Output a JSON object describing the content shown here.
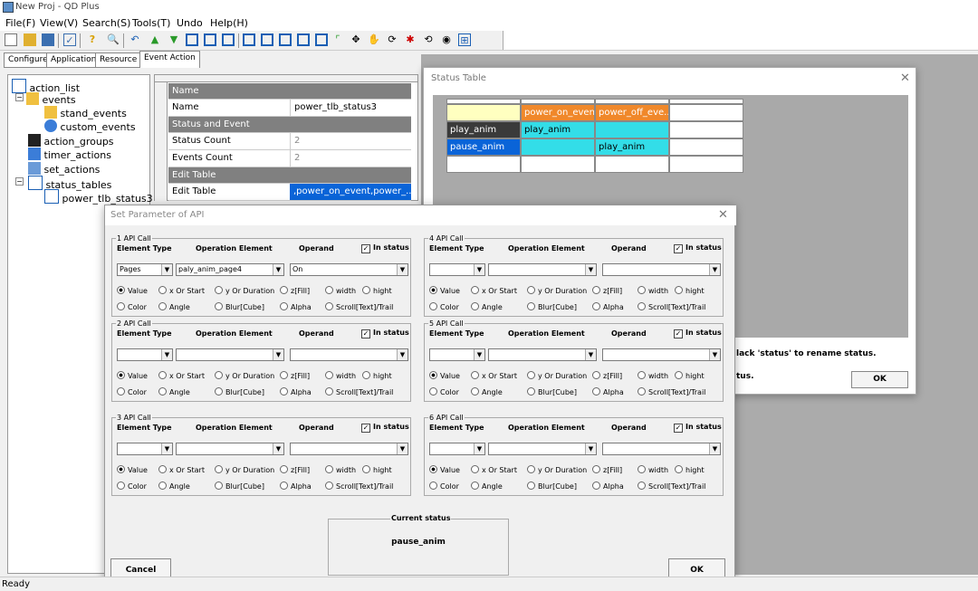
{
  "window": {
    "title": "New Proj - QD Plus"
  },
  "menu": [
    "File(F)",
    "View(V)",
    "Search(S)",
    "Tools(T)",
    "Undo",
    "Help(H)"
  ],
  "tabs": [
    "Configure",
    "Application",
    "Resource",
    "Event Action"
  ],
  "tree": {
    "items": [
      {
        "label": "action_list",
        "icon": "window-icon"
      },
      {
        "label": "events",
        "icon": "folder-icon"
      },
      {
        "label": "stand_events",
        "icon": "stand-events-icon"
      },
      {
        "label": "custom_events",
        "icon": "custom-events-icon"
      },
      {
        "label": "action_groups",
        "icon": "action-groups-icon"
      },
      {
        "label": "timer_actions",
        "icon": "timer-icon"
      },
      {
        "label": "set_actions",
        "icon": "set-actions-icon"
      },
      {
        "label": "status_tables",
        "icon": "table-icon"
      },
      {
        "label": "power_tlb_status3",
        "icon": "table-icon"
      }
    ]
  },
  "property_grid": {
    "rows": [
      {
        "name": "Name",
        "value": "",
        "header": true
      },
      {
        "name": "Name",
        "value": "power_tlb_status3"
      },
      {
        "name": "Status and Event",
        "value": "",
        "header": true
      },
      {
        "name": "Status Count",
        "value": "2"
      },
      {
        "name": "Events Count",
        "value": "2"
      },
      {
        "name": "Edit Table",
        "value": "",
        "header": true
      },
      {
        "name": "Edit Table",
        "value": ",power_on_event,power_..."
      }
    ]
  },
  "status_dialog": {
    "title": "Status Table",
    "columns": [
      "",
      "power_on_event",
      "power_off_eve..."
    ],
    "rows": [
      {
        "status": "play_anim",
        "cells": [
          "play_anim",
          ""
        ]
      },
      {
        "status": "pause_anim",
        "cells": [
          "",
          "play_anim"
        ]
      }
    ],
    "hint1": "lack 'status' to  rename status.",
    "hint2": "tus.",
    "ok_label": "OK"
  },
  "param_dialog": {
    "title": "Set Parameter of API",
    "headers": {
      "element_type": "Element Type",
      "operation_element": "Operation Element",
      "operand": "Operand",
      "in_status": "In status"
    },
    "radio_row1": [
      "Value",
      "x Or Start",
      "y Or Duration",
      "z[Fill]",
      "width",
      "hight"
    ],
    "radio_row2": [
      "Color",
      "Angle",
      "Blur[Cube]",
      "Alpha",
      "Scroll[Text]/Trail"
    ],
    "groups": [
      {
        "label": "1 API Call",
        "element_type": "Pages",
        "operation_element": "paly_anim_page4",
        "operand": "On",
        "in_status": true
      },
      {
        "label": "4 API Call",
        "element_type": "",
        "operation_element": "",
        "operand": "",
        "in_status": true
      },
      {
        "label": "2 API Call",
        "element_type": "",
        "operation_element": "",
        "operand": "",
        "in_status": true
      },
      {
        "label": "5 API Call",
        "element_type": "",
        "operation_element": "",
        "operand": "",
        "in_status": true
      },
      {
        "label": "3 API Call",
        "element_type": "",
        "operation_element": "",
        "operand": "",
        "in_status": true
      },
      {
        "label": "6 API Call",
        "element_type": "",
        "operation_element": "",
        "operand": "",
        "in_status": true
      }
    ],
    "current_status_label": "Current status",
    "current_status_value": "pause_anim",
    "cancel_label": "Cancel",
    "ok_label": "OK"
  },
  "statusbar": {
    "text": "Ready"
  }
}
